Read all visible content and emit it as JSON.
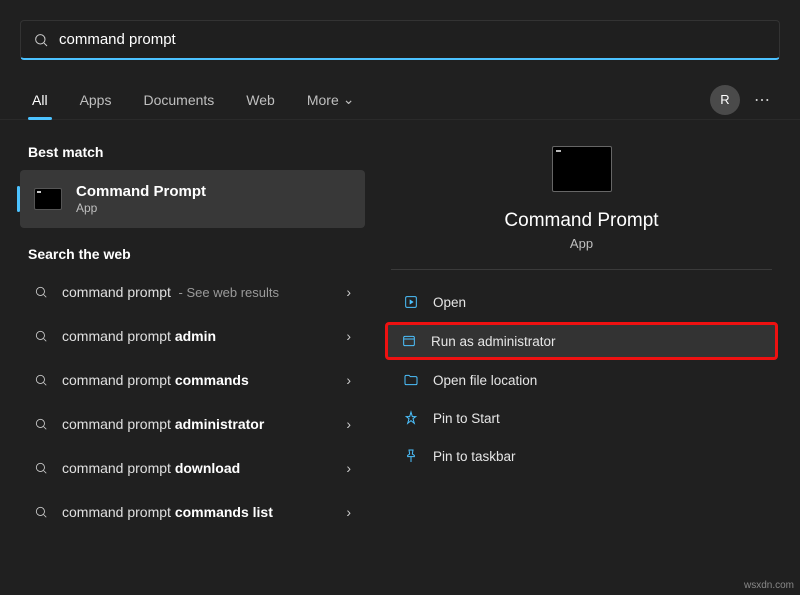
{
  "search": {
    "value": "command prompt"
  },
  "tabs": {
    "all": "All",
    "apps": "Apps",
    "documents": "Documents",
    "web": "Web",
    "more": "More"
  },
  "user": {
    "initial": "R"
  },
  "left": {
    "best_match_header": "Best match",
    "best": {
      "title": "Command Prompt",
      "subtitle": "App"
    },
    "search_web_header": "Search the web",
    "web": [
      {
        "prefix": "command prompt",
        "bold": "",
        "hint": " - See web results"
      },
      {
        "prefix": "command prompt ",
        "bold": "admin",
        "hint": ""
      },
      {
        "prefix": "command prompt ",
        "bold": "commands",
        "hint": ""
      },
      {
        "prefix": "command prompt ",
        "bold": "administrator",
        "hint": ""
      },
      {
        "prefix": "command prompt ",
        "bold": "download",
        "hint": ""
      },
      {
        "prefix": "command prompt ",
        "bold": "commands list",
        "hint": ""
      }
    ]
  },
  "right": {
    "title": "Command Prompt",
    "subtitle": "App",
    "actions": {
      "open": "Open",
      "run_admin": "Run as administrator",
      "open_location": "Open file location",
      "pin_start": "Pin to Start",
      "pin_taskbar": "Pin to taskbar"
    }
  },
  "watermark": "wsxdn.com"
}
